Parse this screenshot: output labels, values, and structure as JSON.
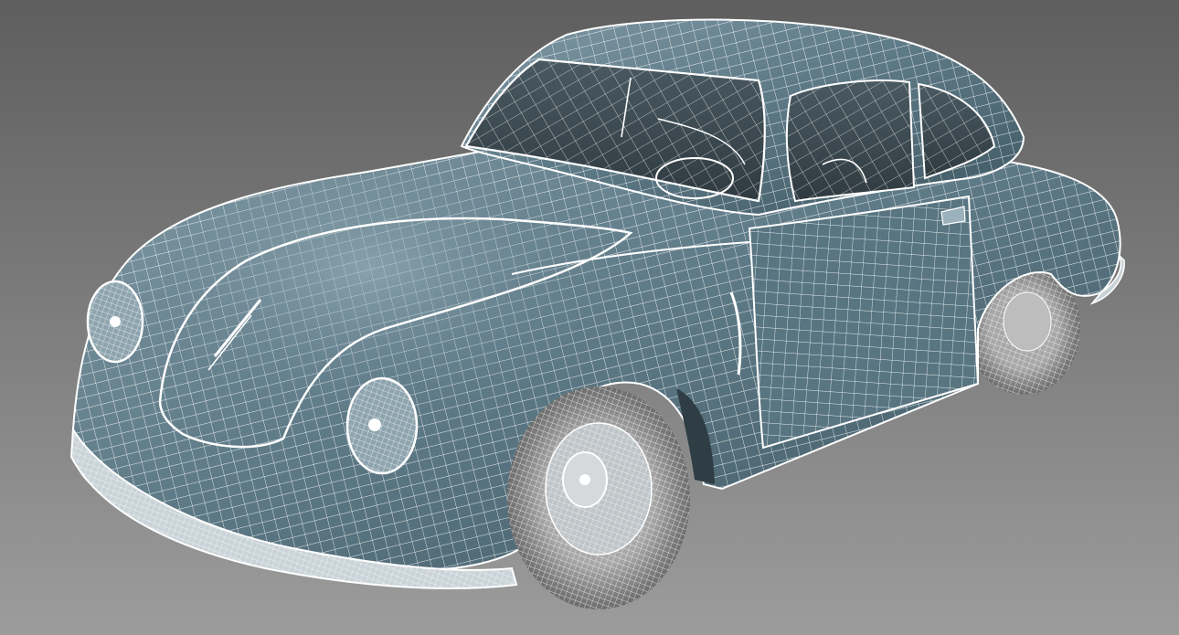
{
  "viewport": {
    "label": "",
    "background_top": "#5e5e5e",
    "background_bottom": "#9c9c9c"
  },
  "model": {
    "name": "",
    "shading": "smooth-with-wireframe-overlay",
    "body_color": "#5f7b88",
    "body_highlight": "#8aa3ae",
    "wire_color": "#ffffff",
    "tire_color": "#8e8e8e"
  }
}
